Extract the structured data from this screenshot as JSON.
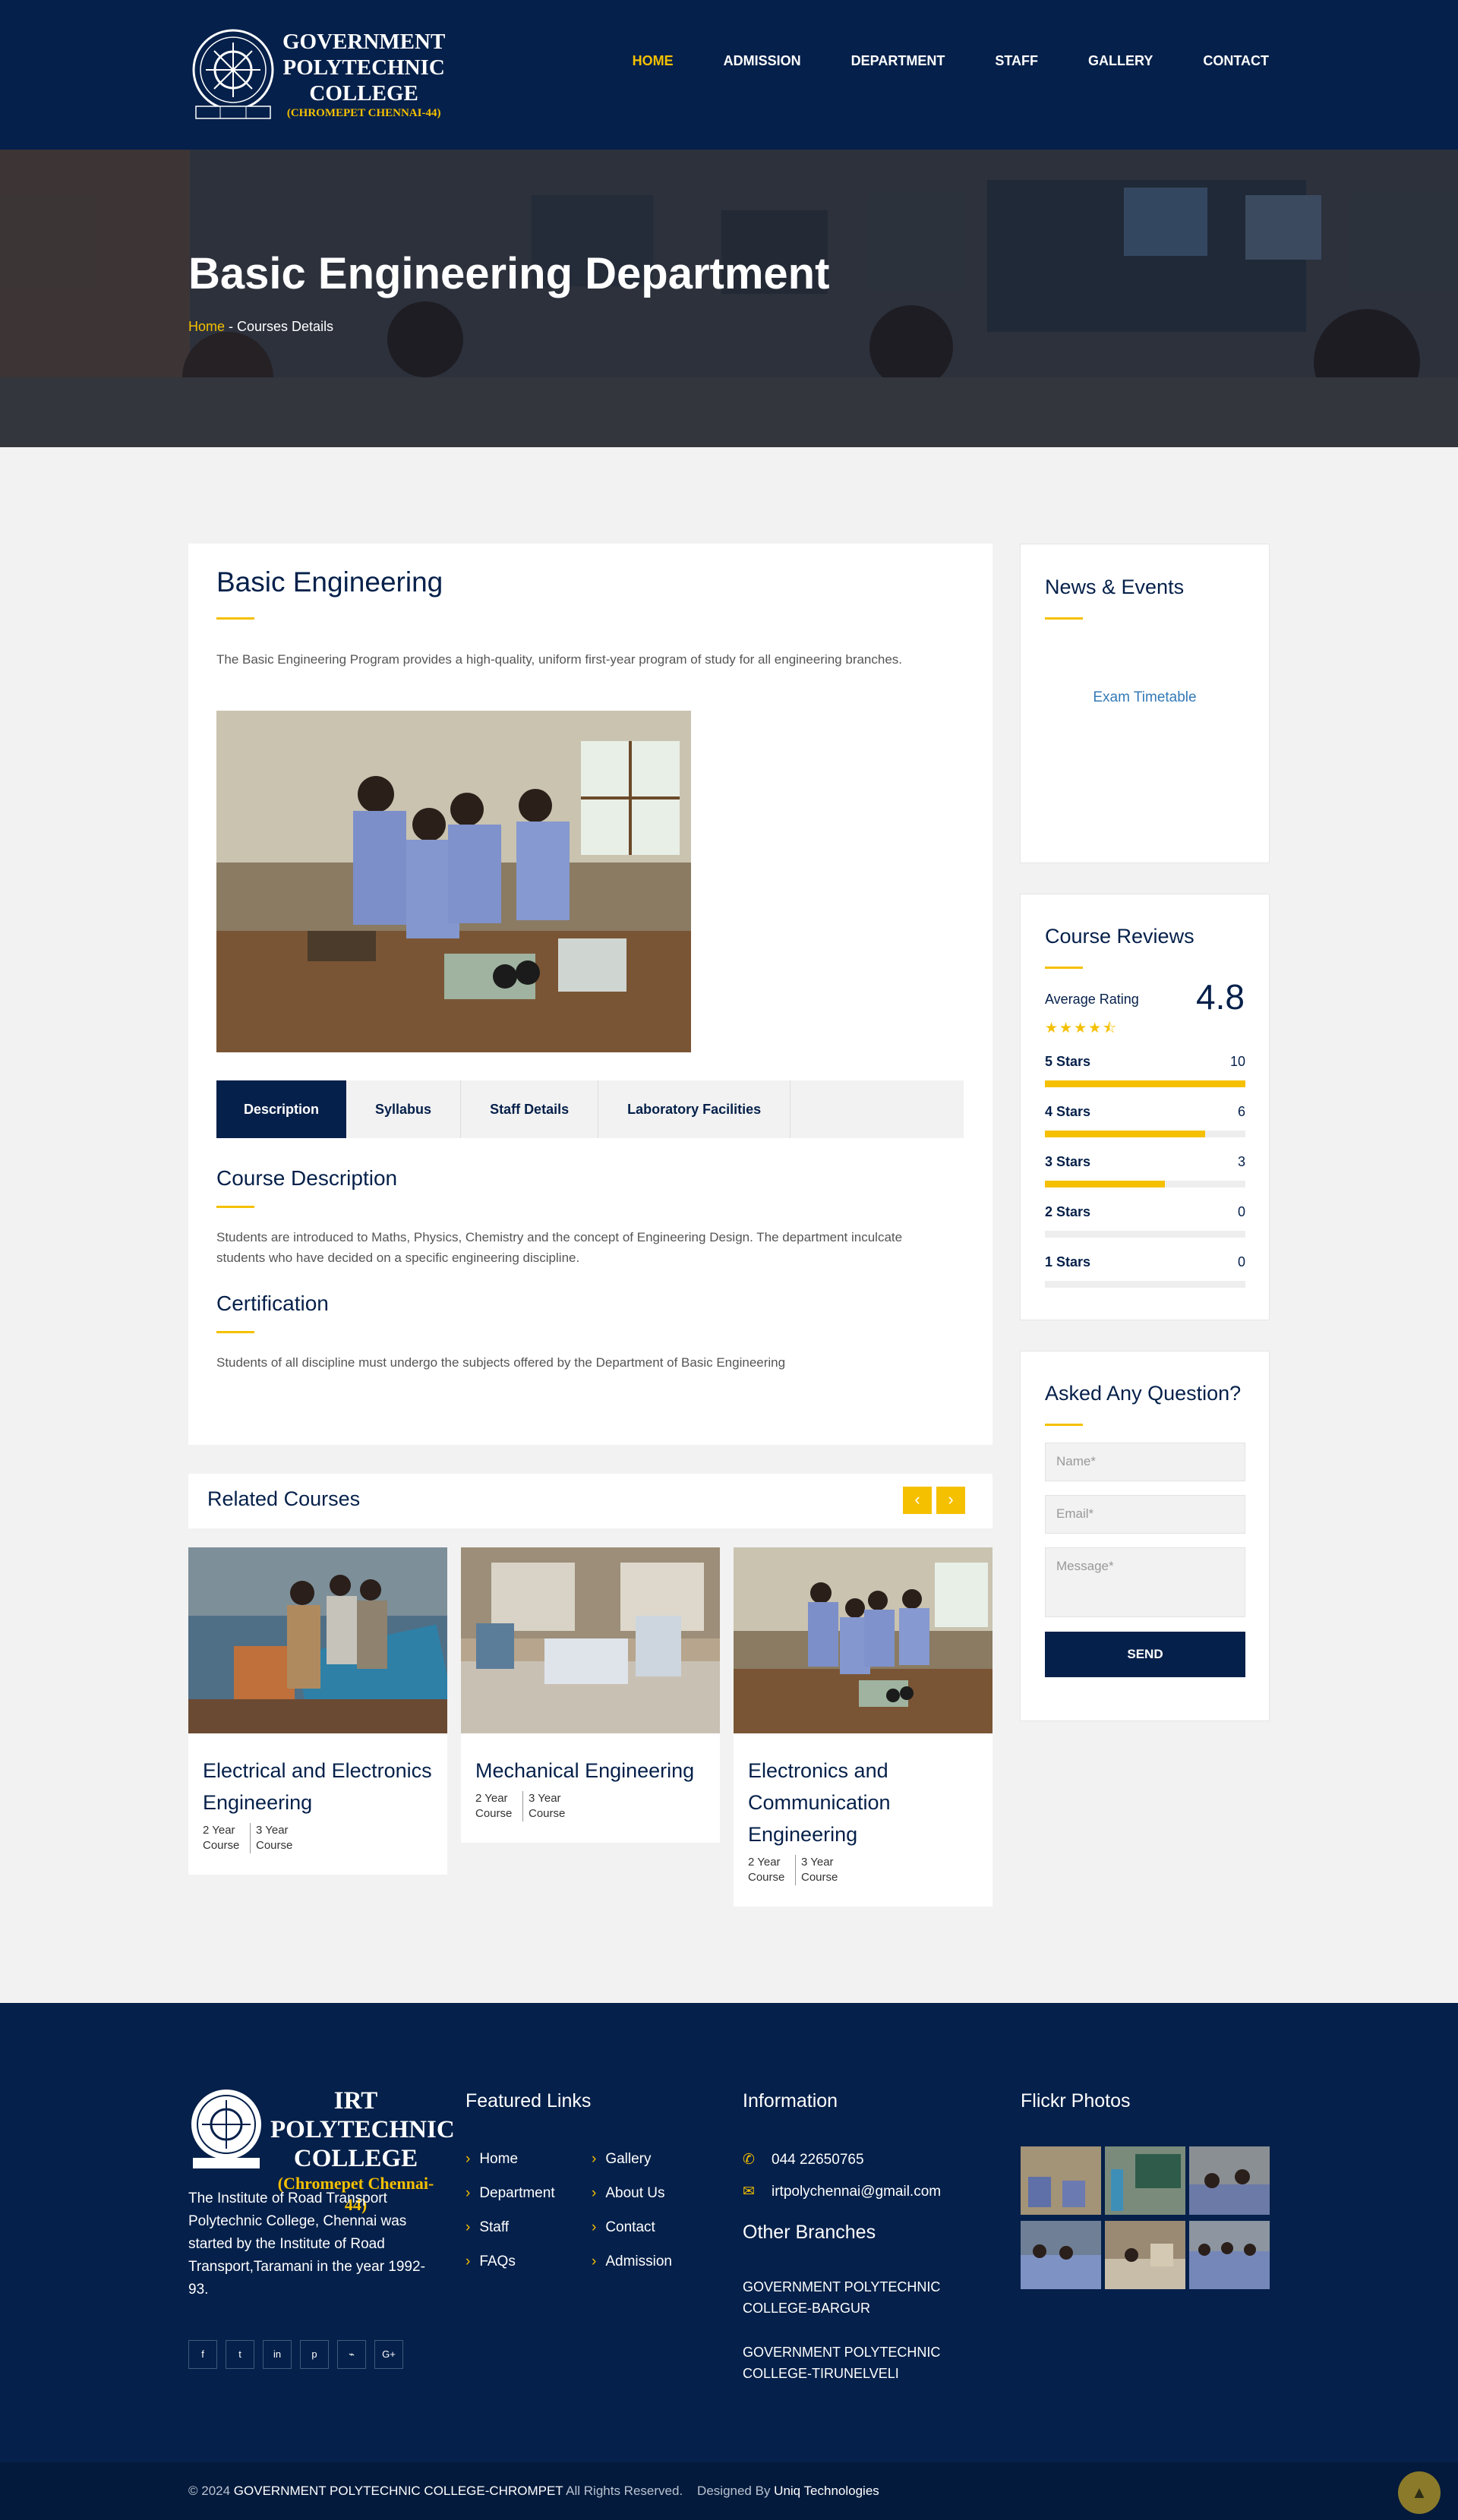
{
  "header": {
    "logo_line1": "GOVERNMENT",
    "logo_line2": "POLYTECHNIC",
    "logo_line3": "COLLEGE",
    "logo_sub": "(CHROMEPET CHENNAI-44)",
    "nav": [
      "HOME",
      "ADMISSION",
      "DEPARTMENT",
      "STAFF",
      "GALLERY",
      "CONTACT"
    ]
  },
  "hero": {
    "title": "Basic Engineering Department",
    "breadcrumb_home": "Home",
    "breadcrumb_sep": " - ",
    "breadcrumb_current": "Courses Details"
  },
  "course": {
    "title": "Basic Engineering",
    "intro": "The Basic Engineering Program provides a high-quality, uniform first-year program of study for all engineering branches.",
    "tabs": [
      "Description",
      "Syllabus",
      "Staff Details",
      "Laboratory Facilities"
    ],
    "desc_title": "Course Description",
    "desc_text": "Students are introduced to Maths, Physics, Chemistry and the concept of Engineering Design. The department inculcate students who have decided on a specific engineering discipline.",
    "cert_title": "Certification",
    "cert_text": "Students of all discipline must undergo the subjects offered by the Department of Basic Engineering"
  },
  "related": {
    "title": "Related Courses",
    "prev": "‹",
    "next": "›",
    "items": [
      {
        "name": "Electrical and Electronics Engineering",
        "meta1": "2 Year Course",
        "meta2": "3 Year Course"
      },
      {
        "name": "Mechanical Engineering",
        "meta1": "2 Year Course",
        "meta2": "3 Year Course"
      },
      {
        "name": "Electronics and Communication Engineering",
        "meta1": "2 Year Course",
        "meta2": "3 Year Course"
      }
    ]
  },
  "sidebar": {
    "news_title": "News & Events",
    "news_link": "Exam Timetable",
    "reviews_title": "Course Reviews",
    "avg_label": "Average Rating",
    "avg_value": "4.8",
    "stars_shown": 4.5,
    "ratings": [
      {
        "label": "5 Stars",
        "count": "10",
        "fraction": 1.0
      },
      {
        "label": "4 Stars",
        "count": "6",
        "fraction": 0.8
      },
      {
        "label": "3 Stars",
        "count": "3",
        "fraction": 0.6
      },
      {
        "label": "2 Stars",
        "count": "0",
        "fraction": 0
      },
      {
        "label": "1 Stars",
        "count": "0",
        "fraction": 0
      }
    ],
    "question_title": "Asked Any Question?",
    "name_placeholder": "Name*",
    "email_placeholder": "Email*",
    "message_placeholder": "Message*",
    "send_label": "SEND"
  },
  "footer": {
    "logo_line1": "IRT POLYTECHNIC",
    "logo_line2": "COLLEGE",
    "logo_sub": "(Chromepet Chennai-44)",
    "about": "The Institute of Road Transport Polytechnic College, Chennai was started by the Institute of Road Transport,Taramani in the year 1992-93.",
    "social_icons": [
      "facebook-icon",
      "twitter-icon",
      "linkedin-icon",
      "pinterest-icon",
      "rss-icon",
      "google-plus-icon"
    ],
    "social_glyphs": [
      "f",
      "t",
      "in",
      "p",
      "⌁",
      "G+"
    ],
    "featured_title": "Featured Links",
    "links_col1": [
      "Home",
      "Department",
      "Staff",
      "FAQs"
    ],
    "links_col2": [
      "Gallery",
      "About Us",
      "Contact",
      "Admission"
    ],
    "info_title": "Information",
    "phone": "044 22650765",
    "email": "irtpolychennai@gmail.com",
    "branches_title": "Other Branches",
    "branch1": "GOVERNMENT POLYTECHNIC COLLEGE-BARGUR",
    "branch2": "GOVERNMENT POLYTECHNIC COLLEGE-TIRUNELVELI",
    "flickr_title": "Flickr Photos"
  },
  "bottom": {
    "copy_prefix": "© 2024 ",
    "college": "GOVERNMENT POLYTECHNIC COLLEGE-CHROMPET",
    "rights": " All Rights Reserved.    Designed By ",
    "designer": "Uniq Technologies"
  },
  "colors": {
    "navy": "#05204a",
    "accent": "#f5c000",
    "link": "#337ab7"
  }
}
